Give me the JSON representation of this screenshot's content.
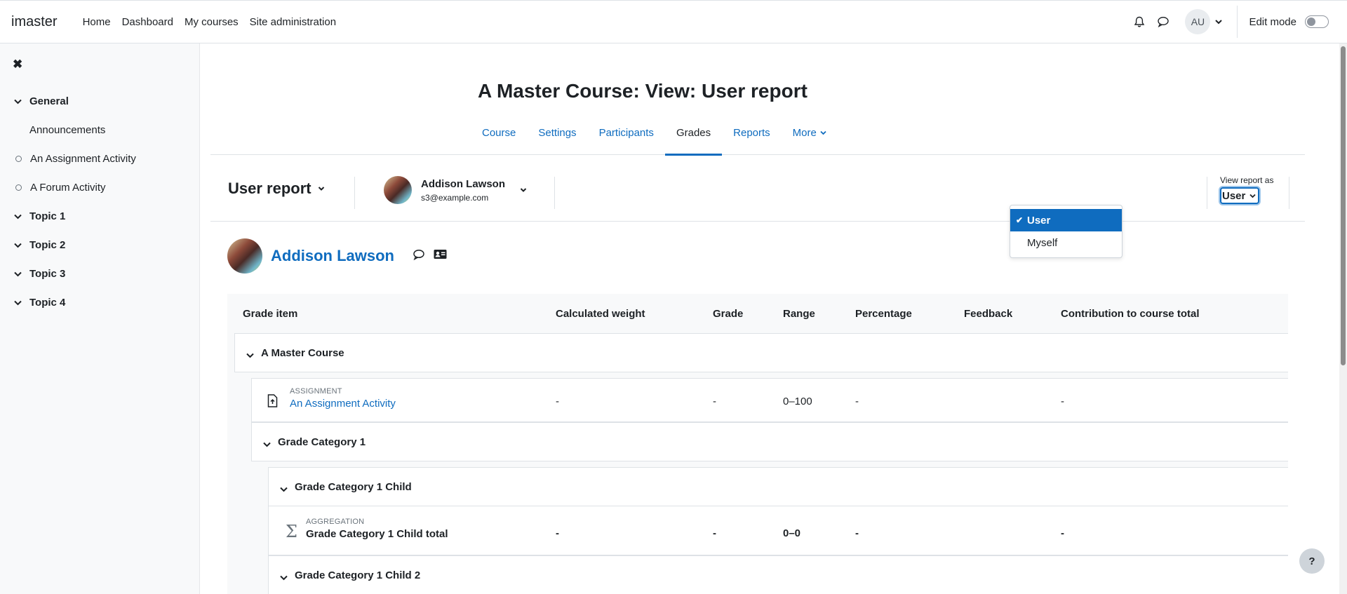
{
  "navbar": {
    "brand": "imaster",
    "links": [
      "Home",
      "Dashboard",
      "My courses",
      "Site administration"
    ],
    "user_initials": "AU",
    "edit_mode_label": "Edit mode"
  },
  "drawer": {
    "items": [
      {
        "label": "General",
        "kind": "section"
      },
      {
        "label": "Announcements",
        "kind": "sub"
      },
      {
        "label": "An Assignment Activity",
        "kind": "activity"
      },
      {
        "label": "A Forum Activity",
        "kind": "activity"
      },
      {
        "label": "Topic 1",
        "kind": "section"
      },
      {
        "label": "Topic 2",
        "kind": "section"
      },
      {
        "label": "Topic 3",
        "kind": "section"
      },
      {
        "label": "Topic 4",
        "kind": "section"
      }
    ]
  },
  "page": {
    "title": "A Master Course: View: User report"
  },
  "secondary_nav": {
    "items": [
      "Course",
      "Settings",
      "Participants",
      "Grades",
      "Reports",
      "More"
    ],
    "active": "Grades"
  },
  "tertiary": {
    "report_label": "User report",
    "user_name": "Addison Lawson",
    "user_email": "s3@example.com",
    "view_as_label": "View report as",
    "view_as_value": "User",
    "view_as_options": [
      {
        "label": "User",
        "selected": true
      },
      {
        "label": "Myself",
        "selected": false
      }
    ]
  },
  "user_heading": {
    "name": "Addison Lawson"
  },
  "grade_table": {
    "headers": [
      "Grade item",
      "Calculated weight",
      "Grade",
      "Range",
      "Percentage",
      "Feedback",
      "Contribution to course total"
    ],
    "course_category": "A Master Course",
    "assignment": {
      "type": "ASSIGNMENT",
      "name": "An Assignment Activity",
      "weight": "-",
      "grade": "-",
      "range": "0–100",
      "percentage": "-",
      "feedback": "",
      "contribution": "-"
    },
    "category1": "Grade Category 1",
    "category1_child": "Grade Category 1 Child",
    "aggregation": {
      "type": "AGGREGATION",
      "name": "Grade Category 1 Child total",
      "weight": "-",
      "grade": "-",
      "range": "0–0",
      "percentage": "-",
      "feedback": "",
      "contribution": "-"
    },
    "category1_child2": "Grade Category 1 Child 2"
  },
  "help_label": "?"
}
